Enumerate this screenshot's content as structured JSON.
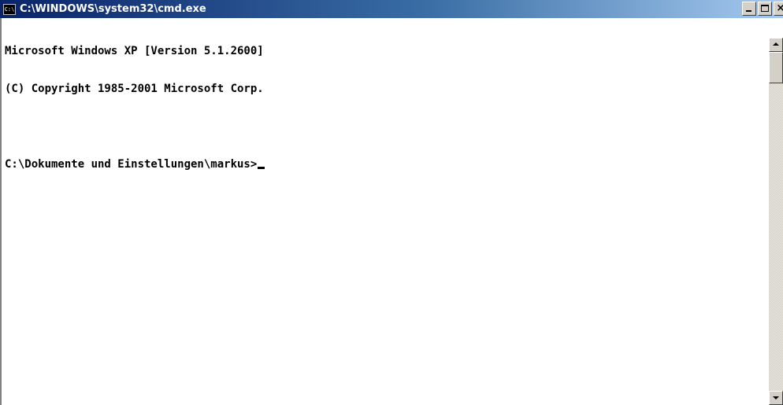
{
  "window": {
    "title": "C:\\WINDOWS\\system32\\cmd.exe",
    "icon": "cmd-icon",
    "buttons": [
      "minimize",
      "maximize",
      "close"
    ],
    "close_glyph": "×"
  },
  "console": {
    "lines": [
      "Microsoft Windows XP [Version 5.1.2600]",
      "(C) Copyright 1985-2001 Microsoft Corp.",
      "",
      "C:\\Dokumente und Einstellungen\\markus>"
    ],
    "background": "#ffffff",
    "foreground": "#000000"
  },
  "colors": {
    "titlebar_start": "#0a246a",
    "titlebar_end": "#a6caf0",
    "button_face": "#d4d0c8"
  }
}
